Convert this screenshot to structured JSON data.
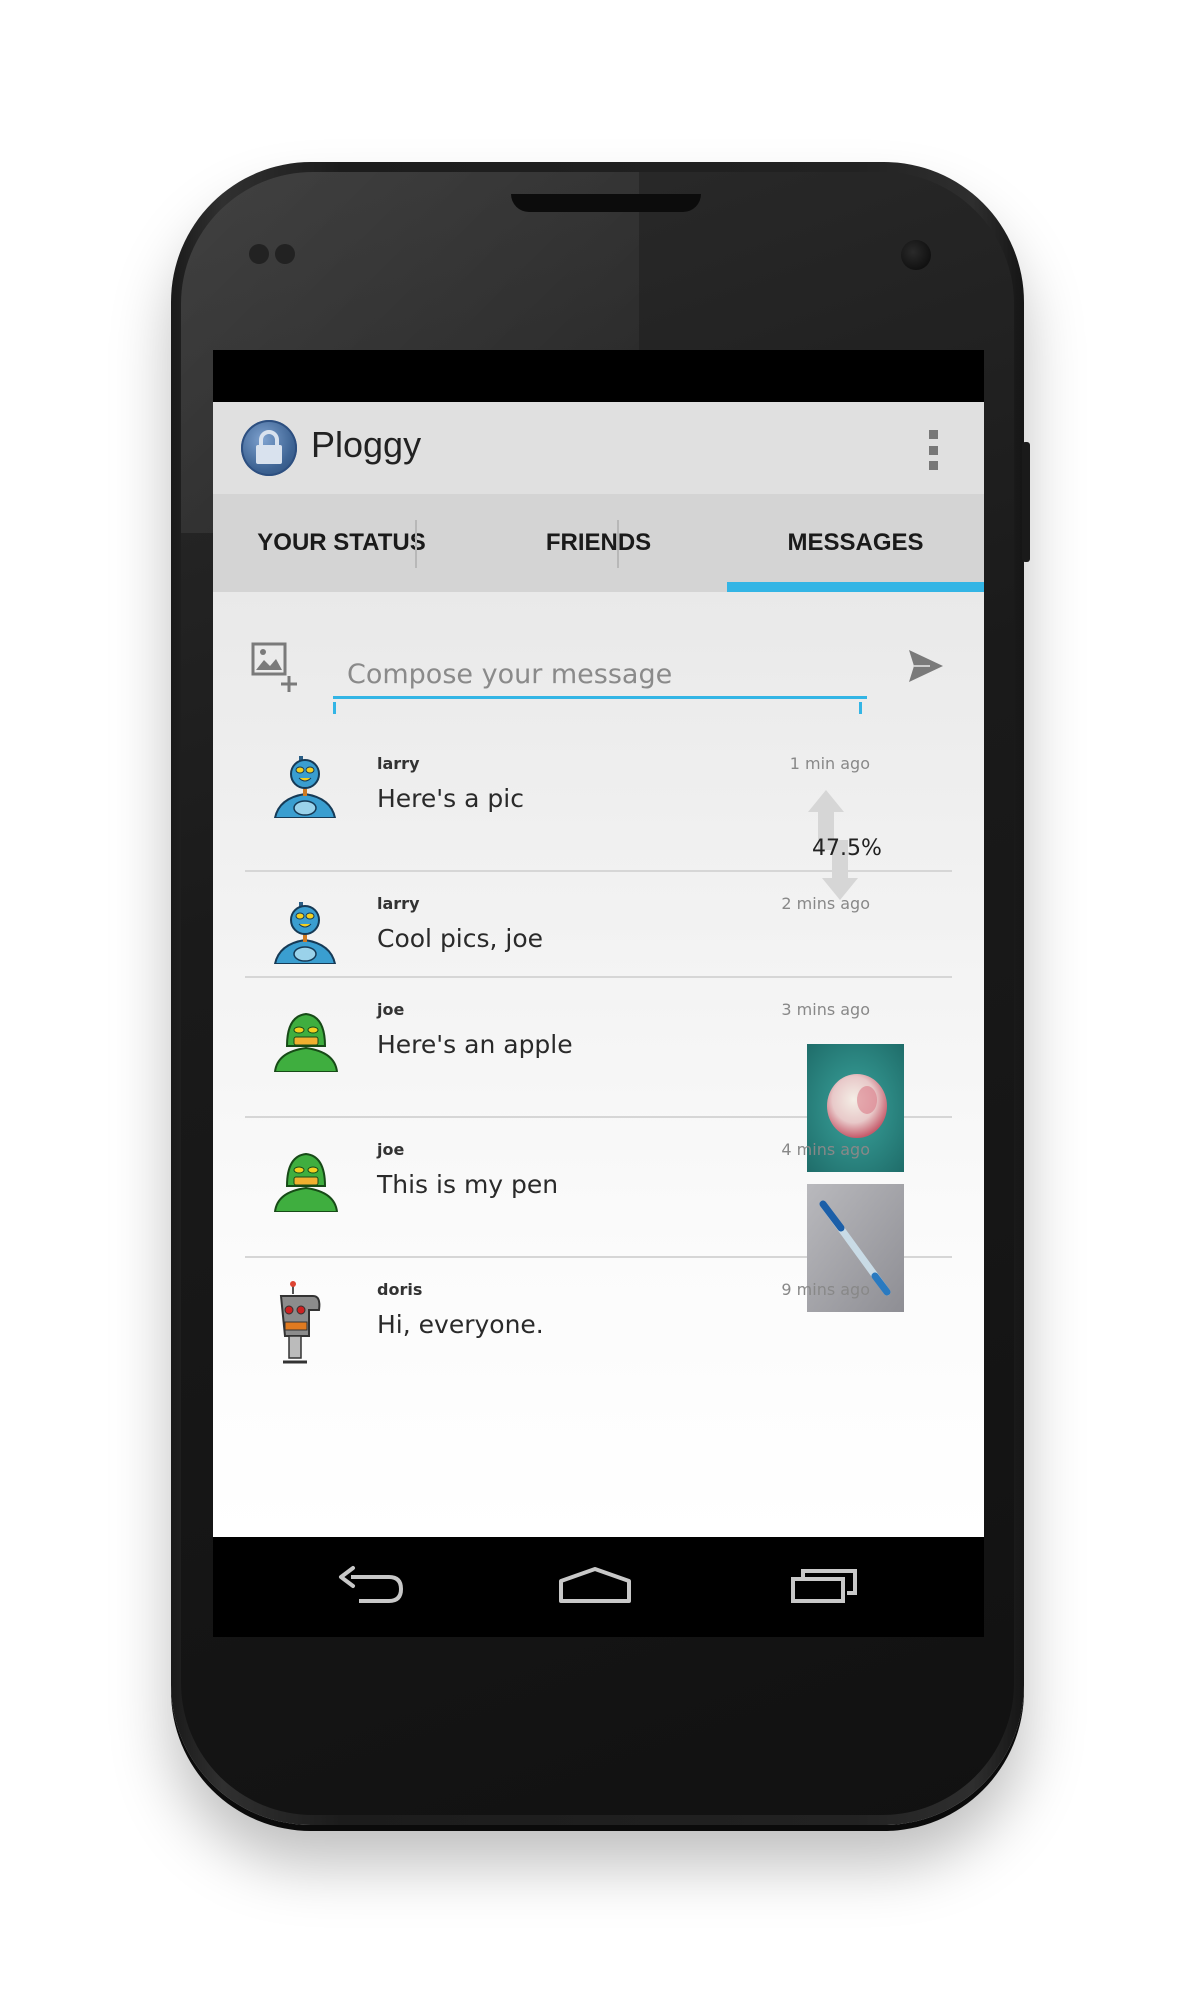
{
  "app": {
    "title": "Ploggy",
    "icon": "padlock-app-icon"
  },
  "tabs": [
    {
      "label": "YOUR STATUS",
      "selected": false
    },
    {
      "label": "FRIENDS",
      "selected": false
    },
    {
      "label": "MESSAGES",
      "selected": true
    }
  ],
  "compose": {
    "placeholder": "Compose your message",
    "value": "",
    "attach_icon": "add-image-icon",
    "send_icon": "send-icon"
  },
  "messages": [
    {
      "author": "larry",
      "time": "1 min ago",
      "text": "Here's a pic",
      "avatar": "blue-robot-avatar",
      "progress": "47.5%"
    },
    {
      "author": "larry",
      "time": "2 mins ago",
      "text": "Cool pics, joe",
      "avatar": "blue-robot-avatar"
    },
    {
      "author": "joe",
      "time": "3 mins ago",
      "text": "Here's an apple",
      "avatar": "green-robot-avatar",
      "image": "apple-photo"
    },
    {
      "author": "joe",
      "time": "4 mins ago",
      "text": "This is my pen",
      "avatar": "green-robot-avatar",
      "image": "pen-photo"
    },
    {
      "author": "doris",
      "time": "9 mins ago",
      "text": "Hi, everyone.",
      "avatar": "grey-robot-avatar"
    }
  ],
  "navigation": [
    "back-icon",
    "home-icon",
    "recent-apps-icon"
  ],
  "colors": {
    "accent": "#33b5e5",
    "actionbar": "#e0e0e0",
    "tabbar": "#d4d4d4"
  }
}
